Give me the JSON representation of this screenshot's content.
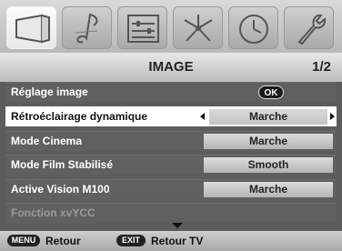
{
  "tabs": [
    {
      "icon": "picture-icon",
      "active": true
    },
    {
      "icon": "music-note-icon",
      "active": false
    },
    {
      "icon": "preferences-sliders-icon",
      "active": false
    },
    {
      "icon": "setup-arrows-icon",
      "active": false
    },
    {
      "icon": "clock-icon",
      "active": false
    },
    {
      "icon": "wrench-icon",
      "active": false
    }
  ],
  "header": {
    "title": "IMAGE",
    "page": "1/2"
  },
  "rows": [
    {
      "label": "Réglage image",
      "action": "OK"
    },
    {
      "label": "Rétroéclairage dynamique",
      "value": "Marche"
    },
    {
      "label": "Mode Cinema",
      "value": "Marche"
    },
    {
      "label": "Mode Film Stabilisé",
      "value": "Smooth"
    },
    {
      "label": "Active Vision M100",
      "value": "Marche"
    },
    {
      "label": "Fonction xvYCC"
    }
  ],
  "footer": {
    "menu_key": "MENU",
    "menu_label": "Retour",
    "exit_key": "EXIT",
    "exit_label": "Retour TV"
  }
}
